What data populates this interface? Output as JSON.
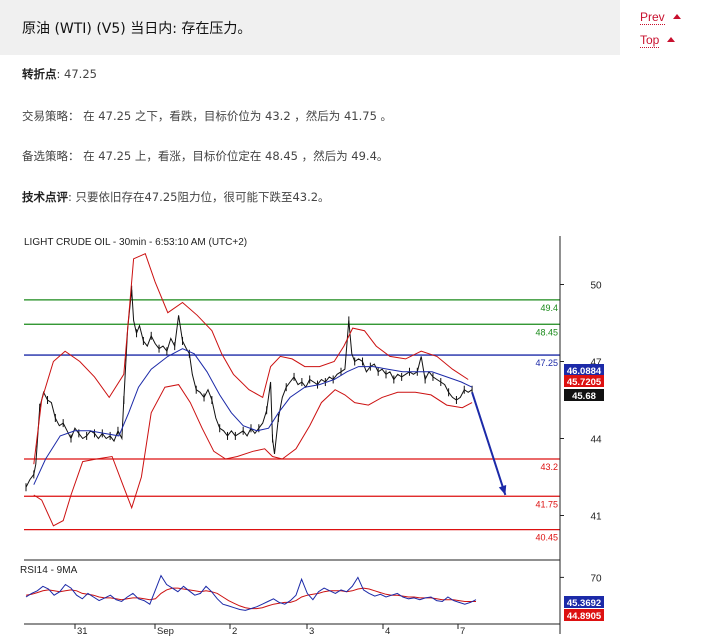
{
  "header": {
    "title": "原油 (WTI) (V5) 当日内: 存在压力。"
  },
  "nav": {
    "prev": "Prev",
    "top": "Top"
  },
  "analysis": {
    "pivot_label": "转折点",
    "pivot_value": ": 47.25",
    "strategy_label": "交易策略",
    "strategy_text": "： 在 47.25 之下，看跌，目标价位为 43.2 ，然后为 41.75 。",
    "alt_label": "备选策略",
    "alt_text": "： 在 47.25 上，看涨，目标价位定在 48.45 ，然后为 49.4。",
    "comment_label": "技术点评",
    "comment_text": ": 只要依旧存在47.25阻力位，很可能下跌至43.2。"
  },
  "chart_data": {
    "type": "line",
    "title": "LIGHT CRUDE OIL - 30min - 6:53:10 AM (UTC+2)",
    "ylim": [
      39.5,
      51.5
    ],
    "y_ticks": [
      50,
      47,
      44,
      41
    ],
    "x_tick_labels": [
      "31",
      "Sep",
      "2",
      "3",
      "4",
      "7"
    ],
    "price_series": [
      {
        "name": "price",
        "points": [
          [
            0,
            42.1
          ],
          [
            4,
            42.4
          ],
          [
            8,
            42.6
          ],
          [
            10,
            43.0
          ],
          [
            14,
            45.2
          ],
          [
            18,
            45.8
          ],
          [
            22,
            45.5
          ],
          [
            26,
            45.4
          ],
          [
            30,
            44.8
          ],
          [
            34,
            44.5
          ],
          [
            38,
            44.6
          ],
          [
            42,
            44.3
          ],
          [
            46,
            44.0
          ],
          [
            50,
            44.4
          ],
          [
            54,
            44.2
          ],
          [
            58,
            44.0
          ],
          [
            62,
            44.1
          ],
          [
            66,
            44.3
          ],
          [
            70,
            44.2
          ],
          [
            74,
            44.0
          ],
          [
            78,
            44.2
          ],
          [
            82,
            44.0
          ],
          [
            86,
            44.1
          ],
          [
            90,
            43.9
          ],
          [
            94,
            44.3
          ],
          [
            98,
            44.0
          ],
          [
            100,
            45.5
          ],
          [
            104,
            48.3
          ],
          [
            108,
            49.8
          ],
          [
            110,
            48.6
          ],
          [
            113,
            48.1
          ],
          [
            116,
            48.4
          ],
          [
            120,
            47.8
          ],
          [
            124,
            47.6
          ],
          [
            128,
            48.0
          ],
          [
            132,
            47.7
          ],
          [
            136,
            47.5
          ],
          [
            140,
            47.6
          ],
          [
            144,
            47.4
          ],
          [
            148,
            47.9
          ],
          [
            152,
            47.6
          ],
          [
            156,
            48.8
          ],
          [
            160,
            47.8
          ],
          [
            164,
            47.5
          ],
          [
            167,
            47.3
          ],
          [
            170,
            46.5
          ],
          [
            174,
            45.9
          ],
          [
            178,
            45.8
          ],
          [
            182,
            45.6
          ],
          [
            186,
            45.9
          ],
          [
            190,
            45.5
          ],
          [
            194,
            44.8
          ],
          [
            198,
            44.4
          ],
          [
            202,
            44.3
          ],
          [
            206,
            44.1
          ],
          [
            210,
            44.3
          ],
          [
            214,
            44.1
          ],
          [
            218,
            44.2
          ],
          [
            222,
            44.3
          ],
          [
            226,
            44.1
          ],
          [
            230,
            44.4
          ],
          [
            234,
            44.2
          ],
          [
            238,
            44.4
          ],
          [
            242,
            44.6
          ],
          [
            246,
            45.1
          ],
          [
            250,
            46.2
          ],
          [
            252,
            44.0
          ],
          [
            254,
            43.4
          ],
          [
            258,
            44.8
          ],
          [
            262,
            45.6
          ],
          [
            266,
            46.0
          ],
          [
            270,
            46.2
          ],
          [
            274,
            46.4
          ],
          [
            278,
            46.1
          ],
          [
            282,
            46.2
          ],
          [
            286,
            46.0
          ],
          [
            290,
            46.3
          ],
          [
            294,
            46.2
          ],
          [
            298,
            46.1
          ],
          [
            302,
            46.3
          ],
          [
            306,
            46.2
          ],
          [
            310,
            46.4
          ],
          [
            314,
            46.3
          ],
          [
            318,
            46.5
          ],
          [
            322,
            46.6
          ],
          [
            326,
            46.7
          ],
          [
            330,
            48.6
          ],
          [
            333,
            47.3
          ],
          [
            336,
            47.0
          ],
          [
            340,
            47.1
          ],
          [
            344,
            47.0
          ],
          [
            348,
            46.6
          ],
          [
            352,
            46.8
          ],
          [
            356,
            46.9
          ],
          [
            360,
            46.6
          ],
          [
            364,
            46.7
          ],
          [
            368,
            46.5
          ],
          [
            372,
            46.6
          ],
          [
            376,
            46.3
          ],
          [
            380,
            46.5
          ],
          [
            384,
            46.4
          ],
          [
            388,
            46.5
          ],
          [
            392,
            46.6
          ],
          [
            396,
            46.5
          ],
          [
            400,
            46.6
          ],
          [
            404,
            47.2
          ],
          [
            408,
            46.3
          ],
          [
            412,
            46.6
          ],
          [
            416,
            46.4
          ],
          [
            420,
            46.3
          ],
          [
            424,
            46.2
          ],
          [
            428,
            46.1
          ],
          [
            432,
            45.8
          ],
          [
            436,
            45.6
          ],
          [
            440,
            45.5
          ],
          [
            444,
            45.6
          ],
          [
            448,
            45.9
          ],
          [
            452,
            45.8
          ],
          [
            456,
            45.9
          ]
        ]
      },
      {
        "name": "bollinger-upper",
        "points": [
          [
            8,
            43.0
          ],
          [
            16,
            45.5
          ],
          [
            28,
            47.0
          ],
          [
            40,
            47.4
          ],
          [
            55,
            47.0
          ],
          [
            70,
            46.4
          ],
          [
            85,
            45.6
          ],
          [
            100,
            46.5
          ],
          [
            110,
            51.0
          ],
          [
            122,
            51.2
          ],
          [
            132,
            50.1
          ],
          [
            145,
            48.9
          ],
          [
            160,
            49.3
          ],
          [
            175,
            48.8
          ],
          [
            190,
            48.2
          ],
          [
            200,
            47.3
          ],
          [
            212,
            46.5
          ],
          [
            228,
            45.9
          ],
          [
            242,
            45.6
          ],
          [
            250,
            46.8
          ],
          [
            260,
            47.2
          ],
          [
            272,
            47.1
          ],
          [
            285,
            46.8
          ],
          [
            300,
            46.8
          ],
          [
            315,
            47.0
          ],
          [
            325,
            47.6
          ],
          [
            334,
            48.3
          ],
          [
            346,
            48.2
          ],
          [
            358,
            47.6
          ],
          [
            372,
            47.2
          ],
          [
            388,
            47.1
          ],
          [
            404,
            47.4
          ],
          [
            420,
            47.2
          ],
          [
            436,
            46.7
          ],
          [
            452,
            46.3
          ]
        ]
      },
      {
        "name": "bollinger-lower",
        "points": [
          [
            8,
            41.8
          ],
          [
            16,
            41.6
          ],
          [
            28,
            40.6
          ],
          [
            38,
            40.8
          ],
          [
            46,
            41.8
          ],
          [
            58,
            43.1
          ],
          [
            72,
            43.2
          ],
          [
            88,
            43.3
          ],
          [
            100,
            42.1
          ],
          [
            108,
            41.3
          ],
          [
            118,
            42.5
          ],
          [
            128,
            45.0
          ],
          [
            142,
            46.0
          ],
          [
            156,
            46.1
          ],
          [
            168,
            45.4
          ],
          [
            180,
            44.4
          ],
          [
            192,
            43.5
          ],
          [
            204,
            43.2
          ],
          [
            216,
            43.3
          ],
          [
            232,
            43.5
          ],
          [
            244,
            43.6
          ],
          [
            252,
            43.3
          ],
          [
            262,
            43.2
          ],
          [
            276,
            43.6
          ],
          [
            290,
            44.5
          ],
          [
            302,
            45.4
          ],
          [
            316,
            45.9
          ],
          [
            326,
            45.7
          ],
          [
            336,
            45.4
          ],
          [
            350,
            45.3
          ],
          [
            364,
            45.6
          ],
          [
            380,
            45.8
          ],
          [
            398,
            45.8
          ],
          [
            414,
            45.7
          ],
          [
            430,
            45.3
          ],
          [
            446,
            45.2
          ],
          [
            456,
            45.4
          ]
        ]
      },
      {
        "name": "moving-average",
        "points": [
          [
            8,
            42.2
          ],
          [
            20,
            43.2
          ],
          [
            35,
            44.1
          ],
          [
            50,
            44.3
          ],
          [
            65,
            44.3
          ],
          [
            80,
            44.2
          ],
          [
            95,
            44.1
          ],
          [
            105,
            45.0
          ],
          [
            115,
            46.0
          ],
          [
            128,
            46.7
          ],
          [
            145,
            47.2
          ],
          [
            160,
            47.5
          ],
          [
            172,
            47.3
          ],
          [
            185,
            46.6
          ],
          [
            198,
            45.7
          ],
          [
            210,
            45.0
          ],
          [
            222,
            44.5
          ],
          [
            236,
            44.3
          ],
          [
            248,
            44.4
          ],
          [
            258,
            45.0
          ],
          [
            270,
            45.6
          ],
          [
            285,
            46.0
          ],
          [
            300,
            46.1
          ],
          [
            315,
            46.3
          ],
          [
            328,
            46.6
          ],
          [
            340,
            46.8
          ],
          [
            355,
            46.8
          ],
          [
            370,
            46.7
          ],
          [
            385,
            46.6
          ],
          [
            400,
            46.6
          ],
          [
            415,
            46.6
          ],
          [
            430,
            46.4
          ],
          [
            445,
            46.2
          ],
          [
            456,
            46.0
          ]
        ]
      }
    ],
    "levels": [
      {
        "value": 49.4,
        "label": "49.4",
        "color": "#1a8a1a"
      },
      {
        "value": 48.45,
        "label": "48.45",
        "color": "#1a8a1a"
      },
      {
        "value": 47.25,
        "label": "47.25",
        "color": "#1c2aa8"
      },
      {
        "value": 43.2,
        "label": "43.2",
        "color": "#dd1111"
      },
      {
        "value": 41.75,
        "label": "41.75",
        "color": "#dd1111"
      },
      {
        "value": 40.45,
        "label": "40.45",
        "color": "#dd1111"
      }
    ],
    "price_tags": [
      {
        "value": 46.0884,
        "label": "46.0884",
        "bg": "#1c2aa8",
        "fg": "#ffffff"
      },
      {
        "value": 45.7205,
        "label": "45.7205",
        "bg": "#dd1111",
        "fg": "#ffffff"
      },
      {
        "value": 45.68,
        "label": "45.68",
        "bg": "#111111",
        "fg": "#ffffff"
      }
    ],
    "projection": {
      "from": [
        456,
        45.8
      ],
      "to": [
        490,
        41.8
      ],
      "color": "#1c2aa8"
    },
    "rsi": {
      "title": "RSI14 - 9MA",
      "y_ticks": [
        70
      ],
      "ylim": [
        20,
        85
      ],
      "rsi_values": [
        48,
        52,
        55,
        60,
        57,
        50,
        54,
        62,
        58,
        50,
        46,
        52,
        48,
        44,
        47,
        50,
        45,
        43,
        48,
        52,
        46,
        44,
        40,
        56,
        72,
        62,
        58,
        54,
        60,
        55,
        50,
        52,
        60,
        54,
        46,
        40,
        38,
        36,
        34,
        33,
        35,
        37,
        40,
        43,
        46,
        42,
        40,
        44,
        50,
        68,
        52,
        45,
        54,
        58,
        55,
        52,
        56,
        54,
        60,
        70,
        56,
        52,
        49,
        51,
        48,
        50,
        52,
        48,
        46,
        47,
        45,
        47,
        48,
        44,
        43,
        48,
        44,
        42,
        40,
        42,
        45
      ],
      "ma_values": [
        50,
        51,
        53,
        55,
        56,
        55,
        54,
        55,
        56,
        55,
        52,
        51,
        50,
        48,
        47,
        47,
        46,
        45,
        46,
        47,
        47,
        46,
        45,
        46,
        52,
        56,
        58,
        58,
        57,
        56,
        55,
        54,
        55,
        54,
        52,
        48,
        44,
        41,
        38,
        36,
        35,
        35,
        36,
        38,
        40,
        41,
        42,
        42,
        44,
        48,
        50,
        51,
        52,
        54,
        55,
        55,
        55,
        54,
        55,
        57,
        58,
        57,
        55,
        53,
        51,
        50,
        50,
        49,
        48,
        48,
        47,
        47,
        47,
        46,
        45,
        45,
        45,
        44,
        43,
        43,
        43
      ],
      "tags": [
        {
          "label": "45.3692",
          "bg": "#1c2aa8",
          "fg": "#ffffff"
        },
        {
          "label": "44.8905",
          "bg": "#dd1111",
          "fg": "#ffffff"
        }
      ]
    }
  }
}
